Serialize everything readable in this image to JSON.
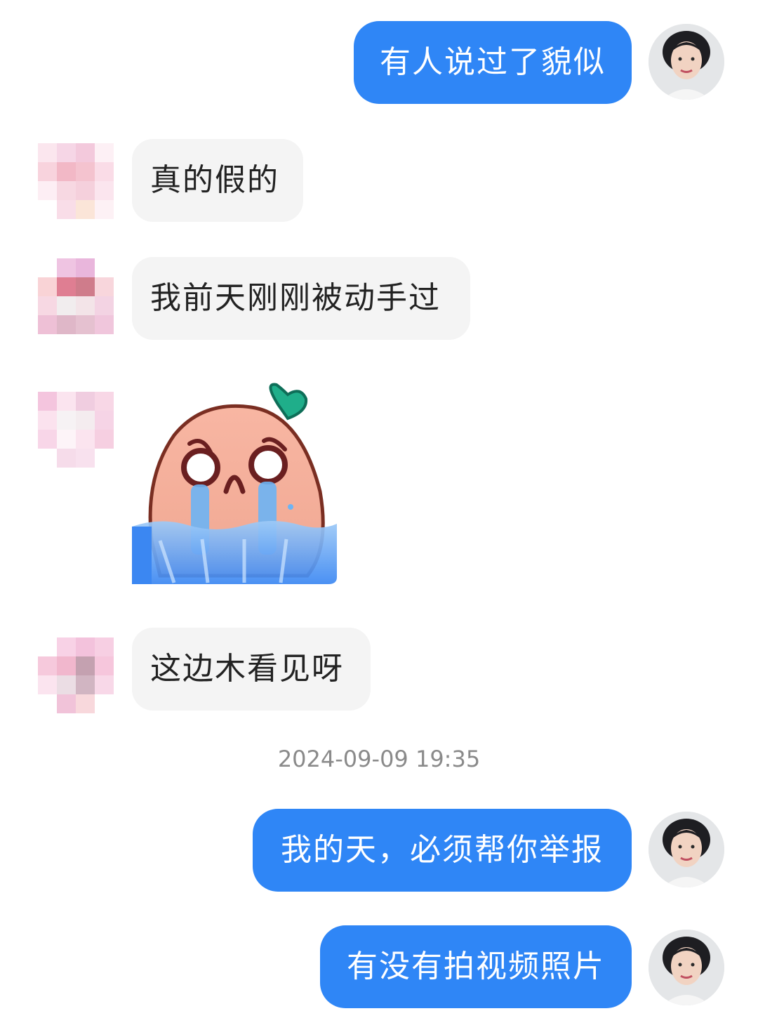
{
  "messages": [
    {
      "side": "out",
      "text": "有人说过了貌似"
    },
    {
      "side": "in",
      "text": "真的假的"
    },
    {
      "side": "in",
      "text": "我前天刚刚被动手过"
    },
    {
      "side": "in",
      "type": "sticker",
      "sticker": "crying-peach-sticker"
    },
    {
      "side": "in",
      "text": "这边木看见呀"
    },
    {
      "side": "out",
      "text": "我的天，必须帮你举报"
    },
    {
      "side": "out",
      "text": "有没有拍视频照片"
    }
  ],
  "timestamp": "2024-09-09 19:35",
  "colors": {
    "outgoing_bubble": "#2f86f6",
    "incoming_bubble": "#f4f4f4",
    "background": "#ffffff"
  }
}
